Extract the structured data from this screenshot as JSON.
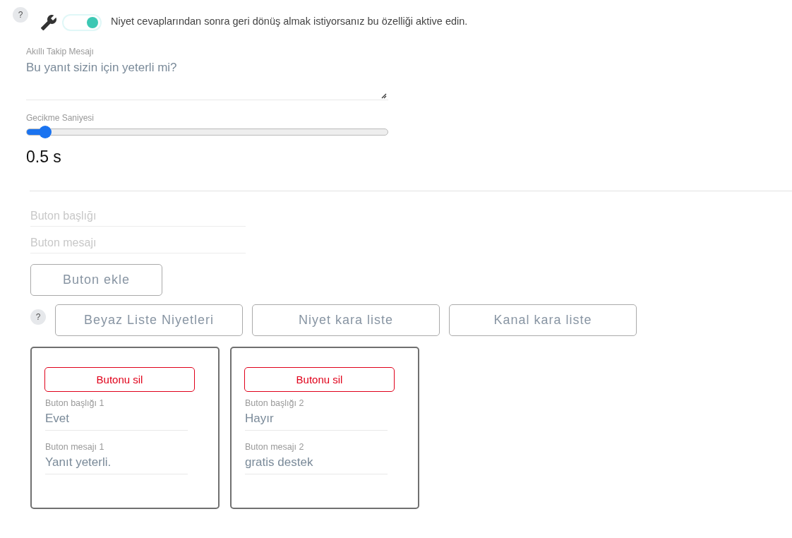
{
  "help_badges": [
    "?",
    "?"
  ],
  "toggle": {
    "on": true,
    "label": "Niyet cevaplarından sonra geri dönüş almak istiyorsanız bu özelliği aktive edin."
  },
  "followup_message": {
    "label": "Akıllı Takip Mesajı",
    "value": "Bu yanıt sizin için yeterli mi?"
  },
  "delay": {
    "label": "Gecikme Saniyesi",
    "level": 0.05,
    "reading": "0.5 s"
  },
  "new_button": {
    "title_placeholder": "Buton başlığı",
    "message_placeholder": "Buton mesajı",
    "add_label": "Buton ekle"
  },
  "list_buttons": [
    "Beyaz Liste Niyetleri",
    "Niyet kara liste",
    "Kanal kara liste"
  ],
  "buttons": [
    {
      "delete_label": "Butonu sil",
      "title_label": "Buton başlığı 1",
      "title": "Evet",
      "message_label": "Buton mesajı 1",
      "message": "Yanıt yeterli."
    },
    {
      "delete_label": "Butonu sil",
      "title_label": "Buton başlığı 2",
      "title": "Hayır",
      "message_label": "Buton mesajı 2",
      "message": "gratis destek"
    }
  ]
}
